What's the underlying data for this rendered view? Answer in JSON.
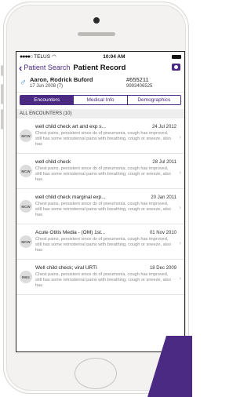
{
  "status_bar": {
    "carrier": "TELUS",
    "time": "10:04 AM"
  },
  "nav": {
    "back_label": "Patient Search",
    "title": "Patient Record"
  },
  "patient": {
    "name": "Aaron, Rodrick Buford",
    "dob": "17 Jun 2008 (7)",
    "number": "#655211",
    "phone": "9993406525"
  },
  "tabs": [
    {
      "label": "Encounters",
      "active": true
    },
    {
      "label": "Medical Info",
      "active": false
    },
    {
      "label": "Demographics",
      "active": false
    }
  ],
  "section_header": "ALL ENCOUNTERS (10)",
  "encounters": [
    {
      "initials": "MCW",
      "title": "well child check art and exp s...",
      "date": "24 Jul 2012",
      "desc": "Chest pains, persistent since dx of pneumonia, cough has improved, still has some retrosternal pains with breathing, cough or sneeze, also has"
    },
    {
      "initials": "MCW",
      "title": "well child check",
      "date": "28 Jul 2011",
      "desc": "Chest pains, persistent since dx of pneumonia, cough has improved, still has some retrosternal pains with breathing, cough or sneeze, also has"
    },
    {
      "initials": "MCW",
      "title": "well child check marginal exp...",
      "date": "20 Jan 2011",
      "desc": "Chest pains, persistent since dx of pneumonia, cough has improved, still has some retrosternal pains with breathing, cough or sneeze, also has"
    },
    {
      "initials": "MCW",
      "title": "Acute Otitis Media - (OM) 1st...",
      "date": "01 Nov 2010",
      "desc": "Chest pains, persistent since dx of pneumonia, cough has improved, still has some retrosternal pains with breathing, cough or sneeze, also has"
    },
    {
      "initials": "RBG",
      "title": "Well child check; viral URTI",
      "date": "18 Dec 2009",
      "desc": "Chest pains, persistent since dx of pneumonia, cough has improved, still has some retrosternal pains with breathing, cough or sneeze, also has"
    }
  ],
  "icons": {
    "back": "chevron-left-icon",
    "camera": "camera-icon",
    "sex": "male-icon",
    "row_chevron": "chevron-right-icon"
  },
  "colors": {
    "accent": "#4b2a83",
    "sex_icon": "#4b8bd6"
  }
}
